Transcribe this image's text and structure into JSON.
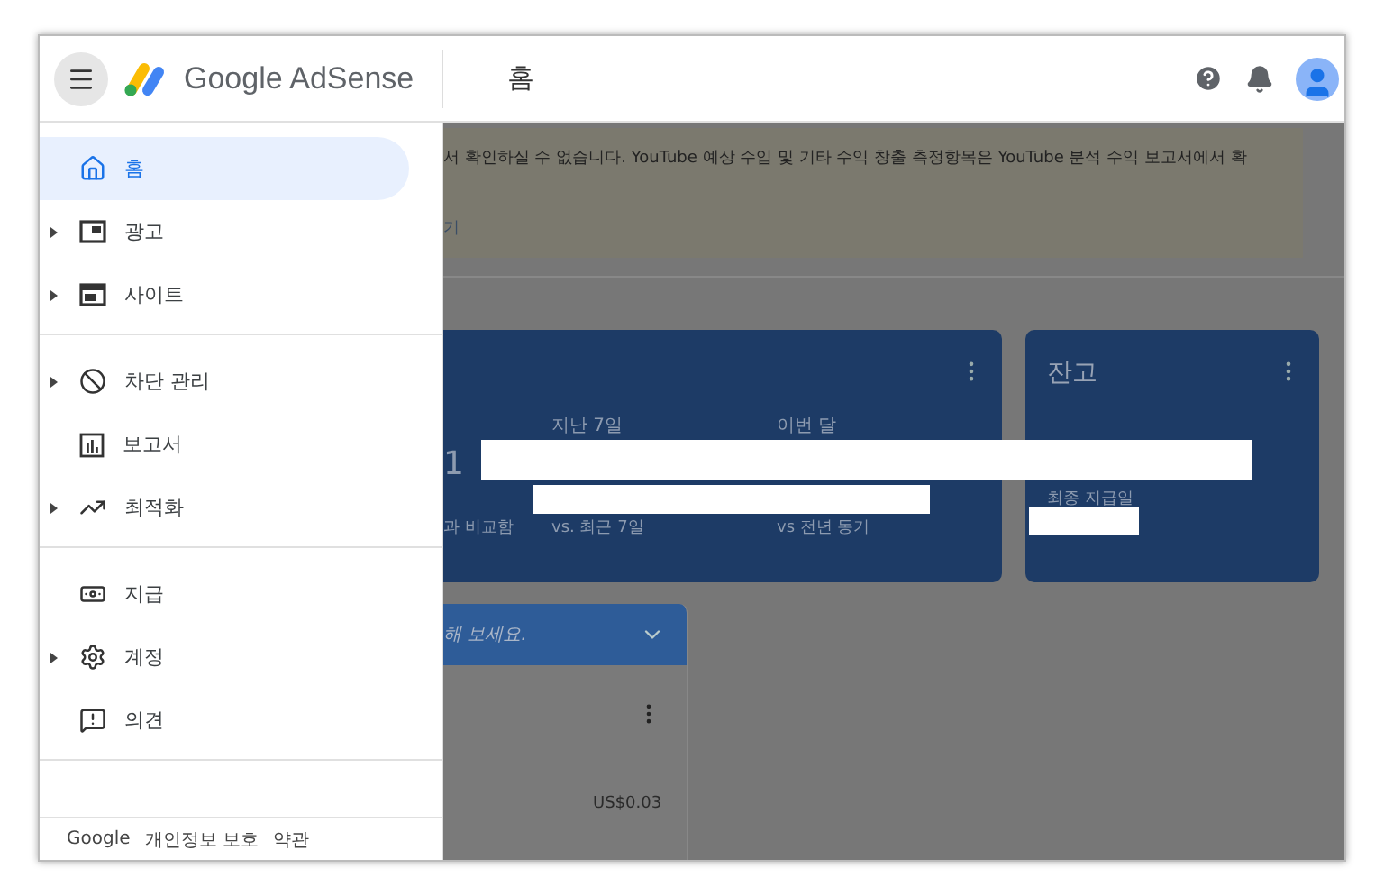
{
  "top_bar": {
    "logo_text": "Google AdSense",
    "page_title": "홈"
  },
  "sidebar": {
    "groups": [
      {
        "items": [
          {
            "label": "홈",
            "expandable": false,
            "selected": true
          },
          {
            "label": "광고",
            "expandable": true,
            "selected": false
          },
          {
            "label": "사이트",
            "expandable": true,
            "selected": false
          }
        ]
      },
      {
        "items": [
          {
            "label": "차단 관리",
            "expandable": true,
            "selected": false
          },
          {
            "label": "보고서",
            "expandable": false,
            "selected": false
          },
          {
            "label": "최적화",
            "expandable": true,
            "selected": false
          }
        ]
      },
      {
        "items": [
          {
            "label": "지급",
            "expandable": false,
            "selected": false
          },
          {
            "label": "계정",
            "expandable": true,
            "selected": false
          },
          {
            "label": "의견",
            "expandable": false,
            "selected": false
          }
        ]
      }
    ],
    "footer_links": [
      "Google",
      "개인정보 보호",
      "약관"
    ]
  },
  "notice": {
    "text": "서 확인하실 수 없습니다. YouTube 예상 수입 및 기타 수익 창출 측정항목은 YouTube 분석 수익 보고서에서 확",
    "link": "기"
  },
  "earnings_card": {
    "value_partial": "1",
    "compare_partial": "과 비교함",
    "columns": [
      {
        "label": "지난 7일",
        "compare": "vs. 최근 7일"
      },
      {
        "label": "이번 달",
        "compare": "vs 전년 동기"
      }
    ]
  },
  "balance_card": {
    "title": "잔고",
    "last_payment_label": "최종 지급일"
  },
  "tip_card": {
    "header": "해 보세요.",
    "amount": "US$0.03"
  }
}
